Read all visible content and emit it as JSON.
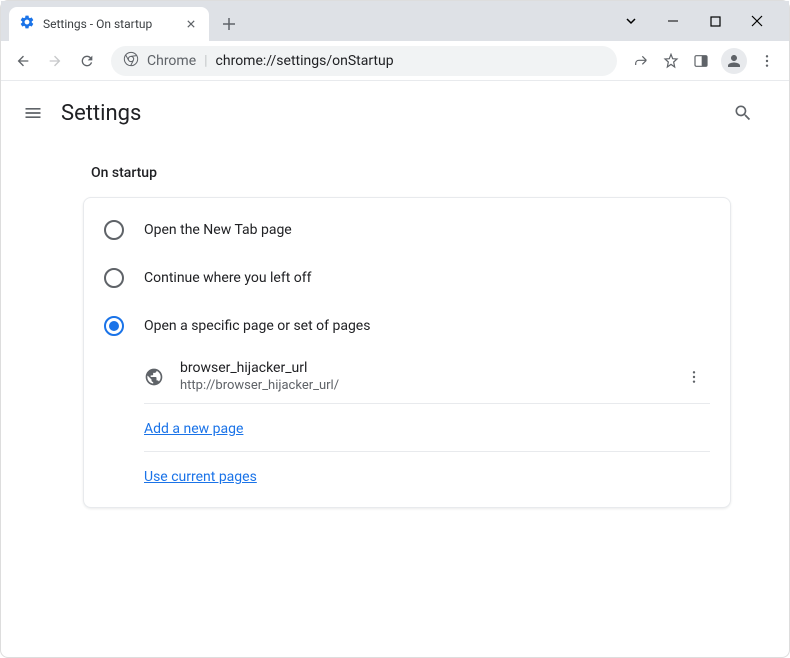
{
  "window": {
    "tab_title": "Settings - On startup"
  },
  "toolbar": {
    "chrome_label": "Chrome",
    "url": "chrome://settings/onStartup"
  },
  "settings": {
    "title": "Settings",
    "section_title": "On startup",
    "options": {
      "new_tab": "Open the New Tab page",
      "continue": "Continue where you left off",
      "specific": "Open a specific page or set of pages"
    },
    "page": {
      "title": "browser_hijacker_url",
      "url": "http://browser_hijacker_url/"
    },
    "links": {
      "add_page": "Add a new page",
      "use_current": "Use current pages"
    }
  }
}
